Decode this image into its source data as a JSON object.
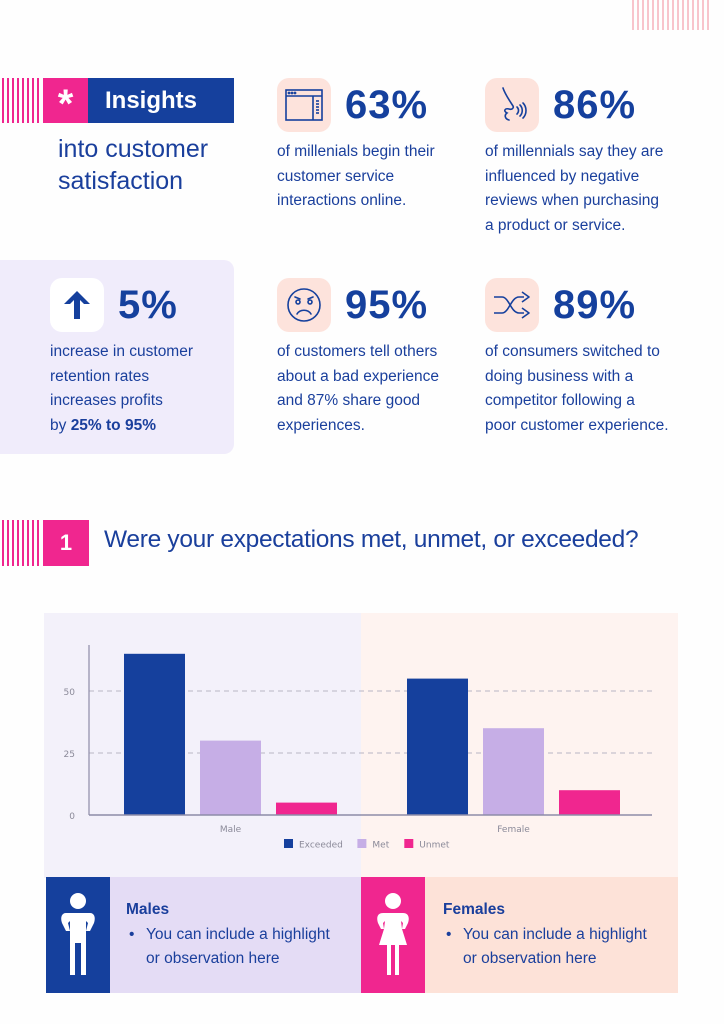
{
  "header": {
    "badge_icon": "asterisk-icon",
    "badge_glyph": "*",
    "title": "Insights",
    "subtitle_line1": "into customer",
    "subtitle_line2": "satisfaction"
  },
  "stats": [
    {
      "icon": "browser-window-icon",
      "value": "63%",
      "lines": [
        "of millenials begin their",
        "customer service",
        "interactions online."
      ]
    },
    {
      "icon": "nose-smell-icon",
      "value": "86%",
      "lines": [
        "of millennials say they are",
        "influenced by negative",
        "reviews when purchasing",
        "a product or service."
      ]
    },
    {
      "icon": "arrow-up-icon",
      "value": "5%",
      "lines": [
        "increase in customer",
        "retention rates",
        "increases profits"
      ],
      "last_prefix": "by ",
      "last_bold": "25% to 95%"
    },
    {
      "icon": "angry-face-icon",
      "value": "95%",
      "lines": [
        "of customers tell others",
        "about a bad experience",
        "and 87% share good",
        "experiences."
      ]
    },
    {
      "icon": "shuffle-icon",
      "value": "89%",
      "lines": [
        "of consumers switched to",
        "doing business with a",
        "competitor following a",
        "poor customer experience."
      ]
    }
  ],
  "question": {
    "number": "1",
    "text": "Were your expectations met, unmet, or exceeded?"
  },
  "colors": {
    "navy": "#15409d",
    "pink": "#f0268f",
    "lilac": "#c6aee6",
    "peach": "#fde3dc"
  },
  "chart_data": {
    "type": "bar",
    "title": "",
    "xlabel": "",
    "ylabel": "",
    "categories": [
      "Male",
      "Female"
    ],
    "series": [
      {
        "name": "Exceeded",
        "color": "#15409d",
        "values": [
          65,
          55
        ]
      },
      {
        "name": "Met",
        "color": "#c6aee6",
        "values": [
          30,
          35
        ]
      },
      {
        "name": "Unmet",
        "color": "#f0268f",
        "values": [
          5,
          10
        ]
      }
    ],
    "yticks": [
      0,
      25,
      50
    ],
    "ylim": [
      0,
      68
    ],
    "grid": true,
    "legend": "bottom-center"
  },
  "notes": [
    {
      "icon": "male-figure-icon",
      "title": "Males",
      "bullet": "You can include a highlight",
      "bullet2": "or observation here"
    },
    {
      "icon": "female-figure-icon",
      "title": "Females",
      "bullet": "You can include a highlight",
      "bullet2": "or observation here"
    }
  ]
}
